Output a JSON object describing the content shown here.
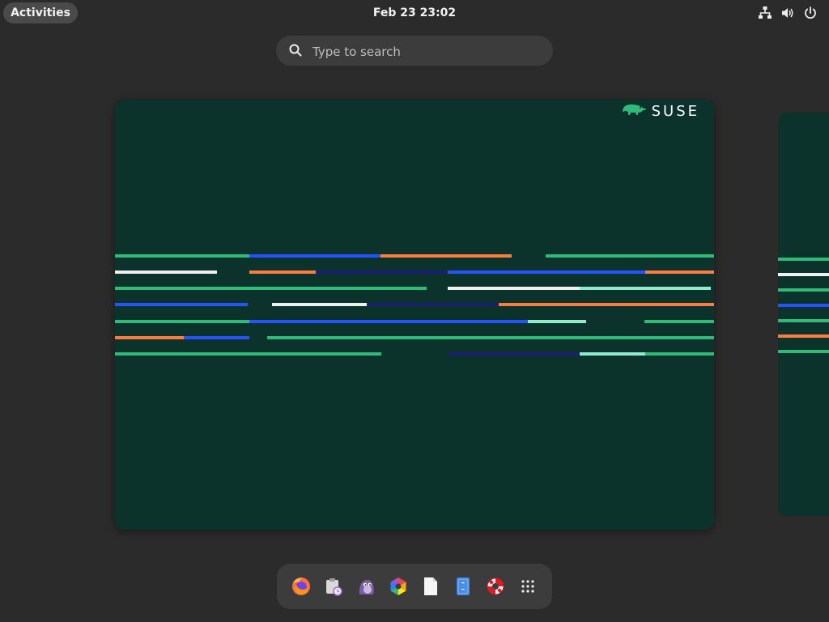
{
  "topbar": {
    "activities_label": "Activities",
    "clock": "Feb 23  23:02",
    "system_icons": [
      "network-icon",
      "volume-icon",
      "power-icon"
    ]
  },
  "search": {
    "placeholder": "Type to search"
  },
  "workspace": {
    "brand": "SUSE",
    "colors": {
      "background": "#0c322c",
      "green": "#30ba78",
      "blue": "#2453ff",
      "orange": "#fe7c3f",
      "navy": "#192072",
      "white": "#efefef",
      "mint": "#90ebcd"
    }
  },
  "dock": {
    "apps": [
      {
        "name": "Firefox",
        "icon": "firefox-icon"
      },
      {
        "name": "Software Updates",
        "icon": "package-update-icon"
      },
      {
        "name": "Pidgin",
        "icon": "pidgin-icon"
      },
      {
        "name": "Color Picker",
        "icon": "color-wheel-icon"
      },
      {
        "name": "Text Document",
        "icon": "document-icon"
      },
      {
        "name": "File Manager",
        "icon": "file-manager-icon"
      },
      {
        "name": "Help",
        "icon": "help-lifebuoy-icon"
      },
      {
        "name": "Show Applications",
        "icon": "app-grid-icon"
      }
    ]
  }
}
